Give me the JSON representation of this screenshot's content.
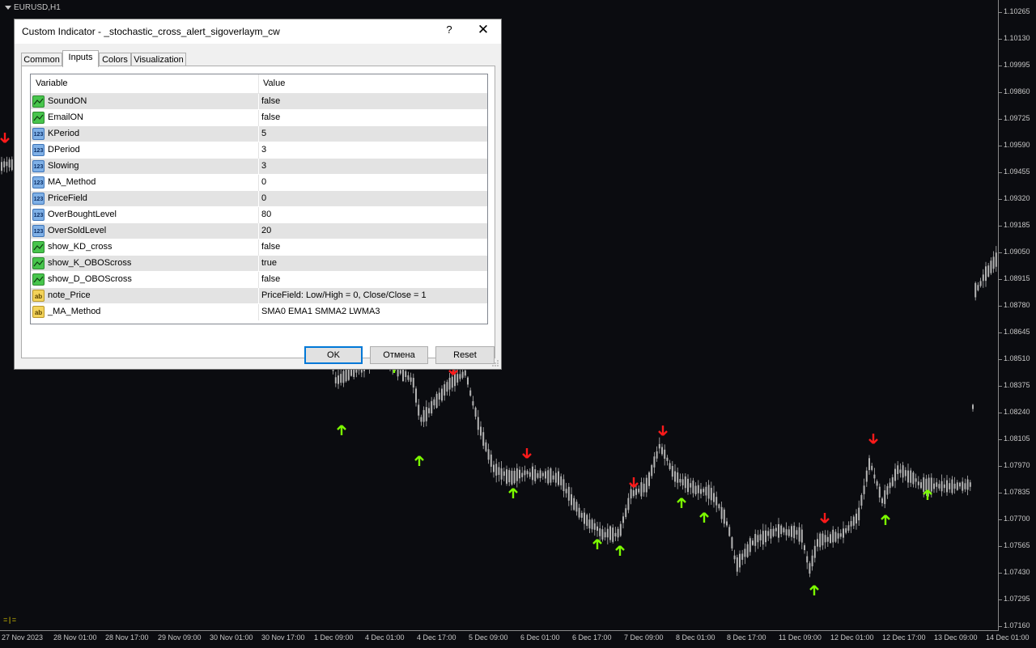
{
  "chart": {
    "symbol": "EURUSD,H1",
    "price_ticks": [
      "1.10265",
      "1.10130",
      "1.09995",
      "1.09860",
      "1.09725",
      "1.09590",
      "1.09455",
      "1.09320",
      "1.09185",
      "1.09050",
      "1.08915",
      "1.08780",
      "1.08645",
      "1.08510",
      "1.08375",
      "1.08240",
      "1.08105",
      "1.07970",
      "1.07835",
      "1.07700",
      "1.07565",
      "1.07430",
      "1.07295",
      "1.07160"
    ],
    "time_ticks": [
      "27 Nov 2023",
      "28 Nov 01:00",
      "28 Nov 17:00",
      "29 Nov 09:00",
      "30 Nov 01:00",
      "30 Nov 17:00",
      "1 Dec 09:00",
      "4 Dec 01:00",
      "4 Dec 17:00",
      "5 Dec 09:00",
      "6 Dec 01:00",
      "6 Dec 17:00",
      "7 Dec 09:00",
      "8 Dec 01:00",
      "8 Dec 17:00",
      "11 Dec 09:00",
      "12 Dec 01:00",
      "12 Dec 17:00",
      "13 Dec 09:00",
      "14 Dec 01:00"
    ],
    "corner_marker": "=|=",
    "colors": {
      "background": "#0b0c10",
      "candle": "#b4b4b4",
      "buy_arrow": "#7cfc00",
      "sell_arrow": "#ff1a1a"
    }
  },
  "dialog": {
    "title": "Custom Indicator - _stochastic_cross_alert_sigoverlaym_cw",
    "help_label": "?",
    "close_label": "✕",
    "tabs": [
      {
        "label": "Common",
        "active": false
      },
      {
        "label": "Inputs",
        "active": true
      },
      {
        "label": "Colors",
        "active": false
      },
      {
        "label": "Visualization",
        "active": false
      }
    ],
    "grid": {
      "col_variable": "Variable",
      "col_value": "Value",
      "rows": [
        {
          "type": "bool",
          "icon": "bool-icon",
          "name": "SoundON",
          "value": "false"
        },
        {
          "type": "bool",
          "icon": "bool-icon",
          "name": "EmailON",
          "value": "false"
        },
        {
          "type": "int",
          "icon": "int-icon",
          "name": "KPeriod",
          "value": "5"
        },
        {
          "type": "int",
          "icon": "int-icon",
          "name": "DPeriod",
          "value": "3"
        },
        {
          "type": "int",
          "icon": "int-icon",
          "name": "Slowing",
          "value": "3"
        },
        {
          "type": "int",
          "icon": "int-icon",
          "name": "MA_Method",
          "value": "0"
        },
        {
          "type": "int",
          "icon": "int-icon",
          "name": "PriceField",
          "value": "0"
        },
        {
          "type": "int",
          "icon": "int-icon",
          "name": "OverBoughtLevel",
          "value": "80"
        },
        {
          "type": "int",
          "icon": "int-icon",
          "name": "OverSoldLevel",
          "value": "20"
        },
        {
          "type": "bool",
          "icon": "bool-icon",
          "name": "show_KD_cross",
          "value": "false"
        },
        {
          "type": "bool",
          "icon": "bool-icon",
          "name": "show_K_OBOScross",
          "value": "true"
        },
        {
          "type": "bool",
          "icon": "bool-icon",
          "name": "show_D_OBOScross",
          "value": "false"
        },
        {
          "type": "str",
          "icon": "string-icon",
          "name": "note_Price",
          "value": "PriceField:  Low/High = 0, Close/Close = 1"
        },
        {
          "type": "str",
          "icon": "string-icon",
          "name": "_MA_Method",
          "value": "SMA0 EMA1 SMMA2 LWMA3"
        }
      ]
    },
    "icon_text": {
      "int": "123",
      "str": "ab"
    },
    "buttons": {
      "ok": "OK",
      "cancel": "Отмена",
      "reset": "Reset"
    }
  }
}
